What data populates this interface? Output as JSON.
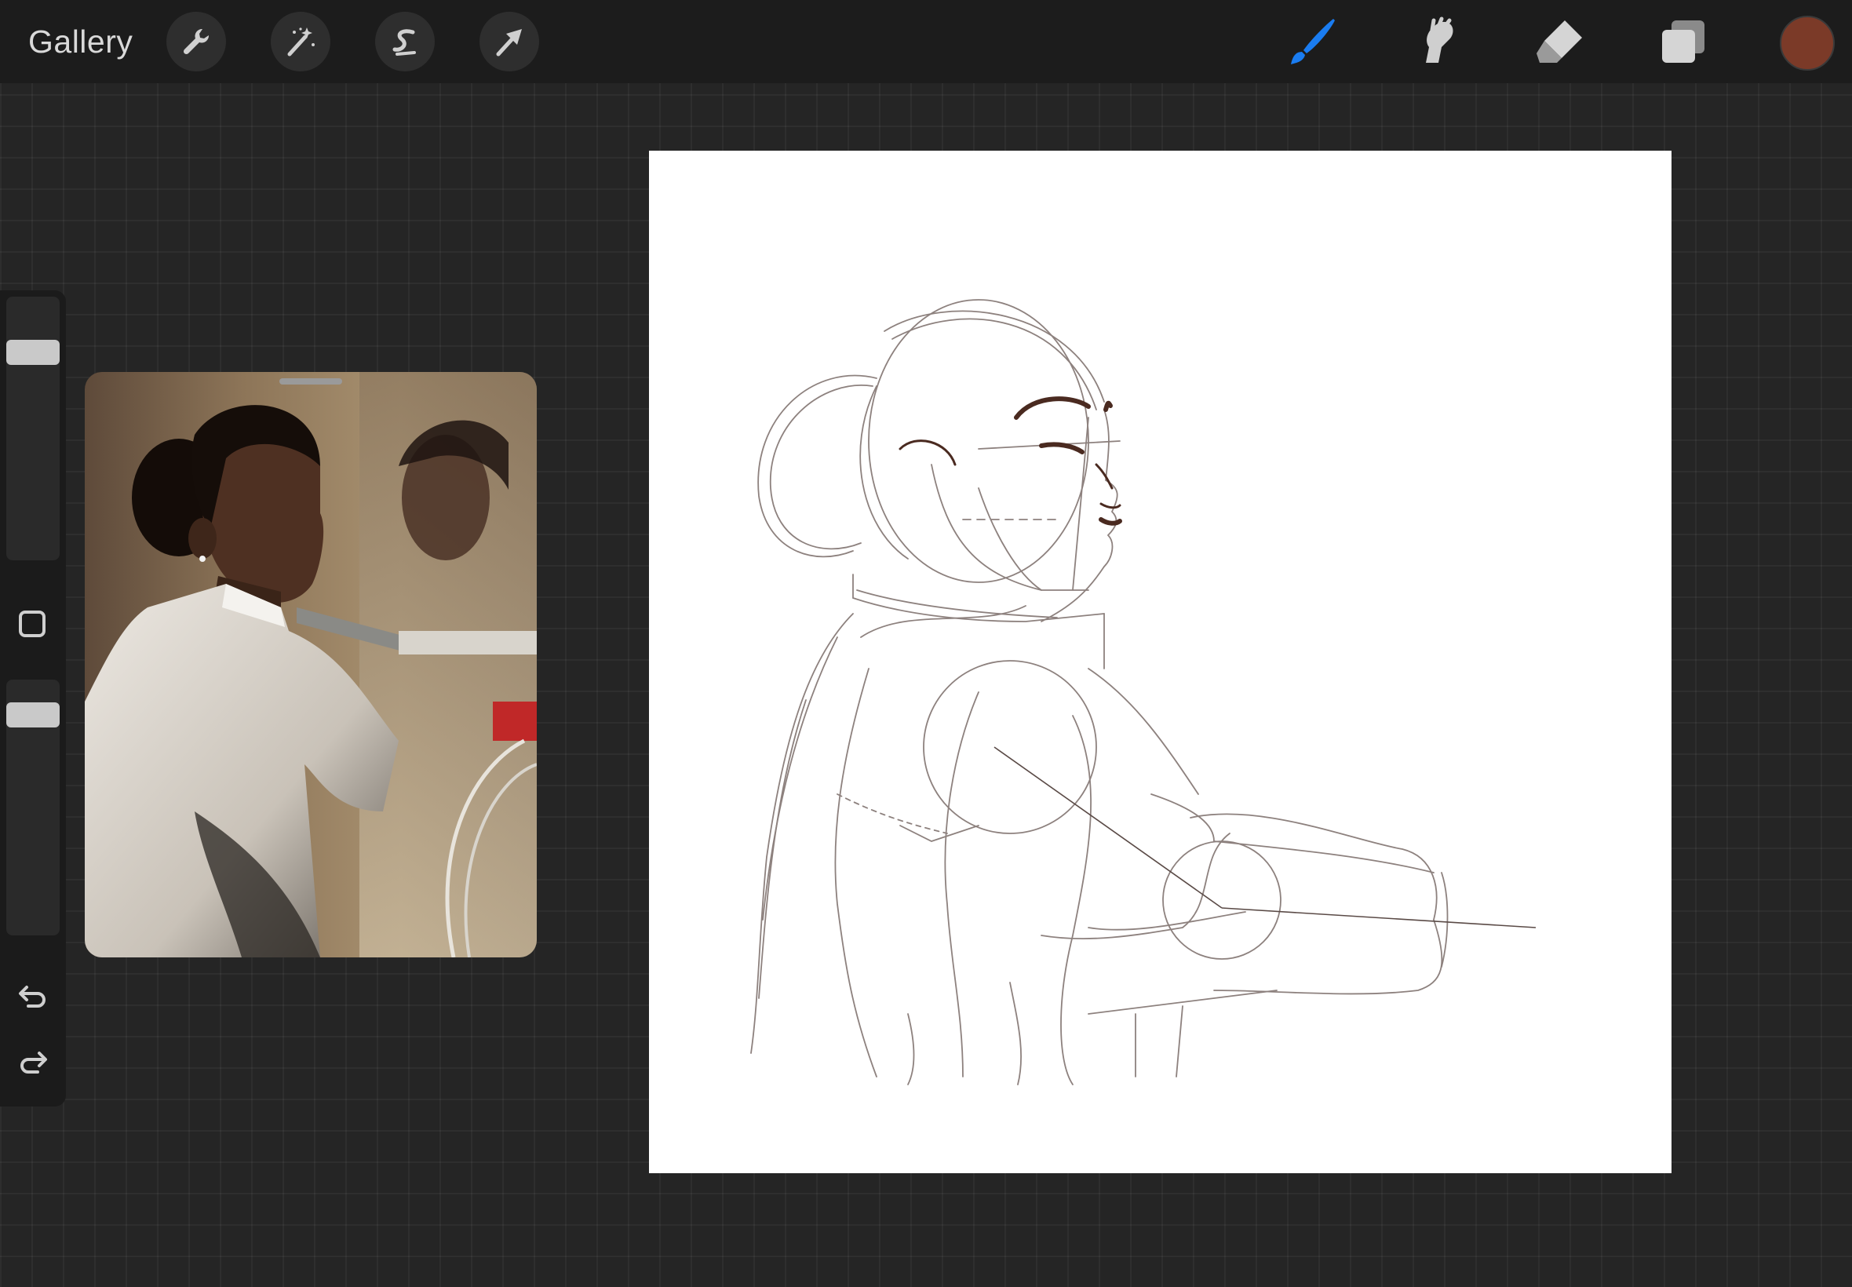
{
  "toolbar": {
    "gallery_label": "Gallery",
    "left_tools": [
      {
        "icon": "wrench-icon"
      },
      {
        "icon": "magic-wand-icon"
      },
      {
        "icon": "selection-s-icon"
      },
      {
        "icon": "transform-arrow-icon"
      }
    ],
    "right_tools": [
      {
        "icon": "brush-icon",
        "active": true
      },
      {
        "icon": "smudge-icon",
        "active": false
      },
      {
        "icon": "eraser-icon",
        "active": false
      },
      {
        "icon": "layers-icon",
        "active": false
      }
    ],
    "current_color": "#7b3a28",
    "active_tool_color": "#1a7cf0"
  },
  "sidebar": {
    "brush_size_level": 0.82,
    "opacity_level": 0.9
  },
  "reference": {
    "description_visible": false
  },
  "canvas": {
    "background": "#ffffff",
    "sketch_color": "#6b5a55",
    "ink_color": "#4a2a20"
  }
}
